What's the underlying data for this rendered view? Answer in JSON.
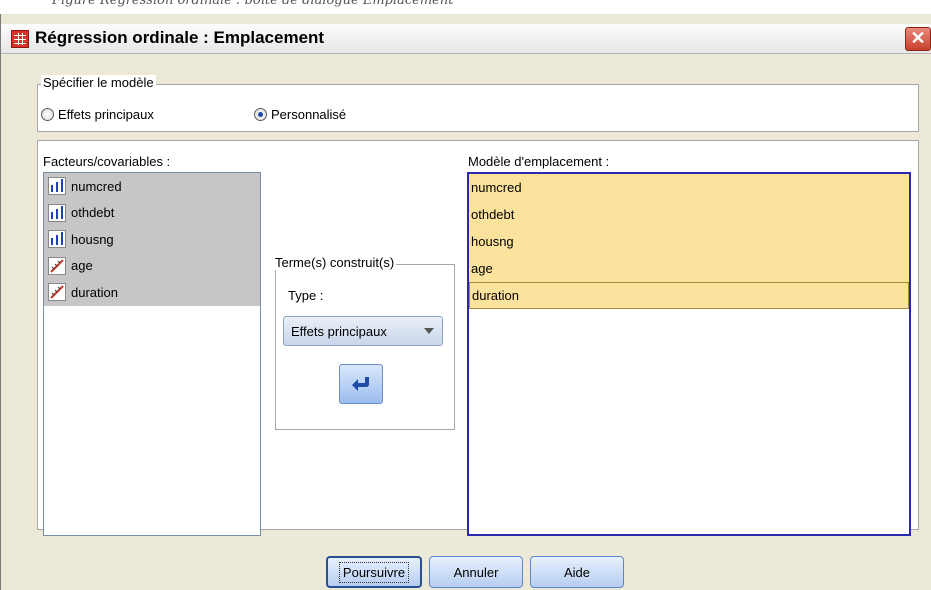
{
  "caption": "Figure  Regression ordinale : boîte de dialogue Emplacement",
  "window": {
    "title": "Régression ordinale : Emplacement",
    "close_glyph": "✕"
  },
  "model_group": {
    "legend": "Spécifier le modèle",
    "options": [
      {
        "label": "Effets principaux",
        "selected": false
      },
      {
        "label": "Personnalisé",
        "selected": true
      }
    ]
  },
  "factors": {
    "label": "Facteurs/covariables :",
    "items": [
      {
        "name": "numcred",
        "icon": "ordinal-scale-icon"
      },
      {
        "name": "othdebt",
        "icon": "ordinal-scale-icon"
      },
      {
        "name": "housng",
        "icon": "ordinal-scale-icon"
      },
      {
        "name": "age",
        "icon": "scale-ruler-icon"
      },
      {
        "name": "duration",
        "icon": "scale-ruler-icon"
      }
    ]
  },
  "build_terms": {
    "legend": "Terme(s) construit(s)",
    "type_label": "Type :",
    "type_value": "Effets principaux",
    "move_icon": "arrow-right-icon"
  },
  "location_model": {
    "label": "Modèle d'emplacement :",
    "items": [
      "numcred",
      "othdebt",
      "housng",
      "age",
      "duration"
    ]
  },
  "buttons": {
    "continue": "Poursuivre",
    "cancel": "Annuler",
    "help": "Aide"
  }
}
